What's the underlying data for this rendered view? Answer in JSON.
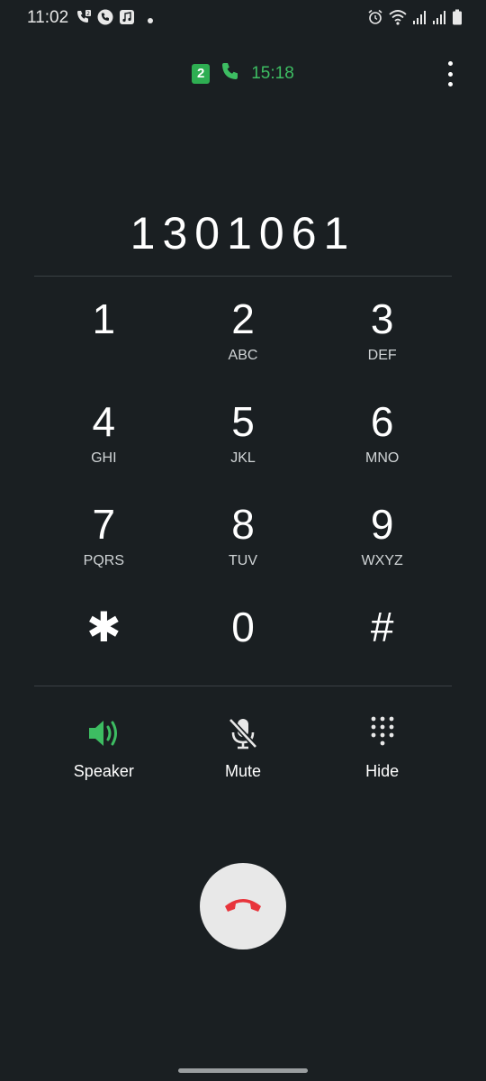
{
  "status_bar": {
    "time": "11:02",
    "left_icons": [
      "sim2-call-icon",
      "phone-icon",
      "music-icon",
      "notification-dot-icon"
    ],
    "right_icons": [
      "alarm-icon",
      "wifi-icon",
      "signal-icon",
      "signal-icon",
      "battery-icon"
    ]
  },
  "call": {
    "sim_label": "2",
    "duration": "15:18",
    "number": "1301061"
  },
  "keypad": [
    {
      "digit": "1",
      "letters": ""
    },
    {
      "digit": "2",
      "letters": "ABC"
    },
    {
      "digit": "3",
      "letters": "DEF"
    },
    {
      "digit": "4",
      "letters": "GHI"
    },
    {
      "digit": "5",
      "letters": "JKL"
    },
    {
      "digit": "6",
      "letters": "MNO"
    },
    {
      "digit": "7",
      "letters": "PQRS"
    },
    {
      "digit": "8",
      "letters": "TUV"
    },
    {
      "digit": "9",
      "letters": "WXYZ"
    },
    {
      "digit": "✱",
      "letters": ""
    },
    {
      "digit": "0",
      "letters": ""
    },
    {
      "digit": "#",
      "letters": ""
    }
  ],
  "controls": {
    "speaker": "Speaker",
    "mute": "Mute",
    "hide": "Hide"
  },
  "colors": {
    "background": "#1a1f22",
    "accent_green": "#3dbd62",
    "end_call_red": "#e8343b"
  }
}
